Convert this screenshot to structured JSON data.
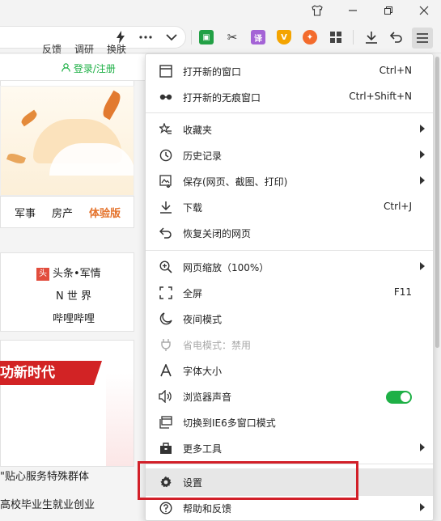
{
  "titlebar": {
    "icons": [
      "shirt-icon",
      "minimize-icon",
      "restore-icon",
      "close-icon"
    ]
  },
  "toolbar": {
    "icons": [
      "lightning-icon",
      "more-icon",
      "chevron-down-icon"
    ],
    "extensions": [
      {
        "name": "book-extension-icon",
        "color": "#22a045",
        "glyph": "▣"
      },
      {
        "name": "scissors-icon",
        "color": "#444444",
        "glyph": "✂"
      },
      {
        "name": "translate-extension-icon",
        "color": "#a463d6",
        "glyph": "译"
      },
      {
        "name": "shield-extension-icon",
        "color": "#f4a400",
        "glyph": "V"
      },
      {
        "name": "gamepad-extension-icon",
        "color": "#f36b2c",
        "glyph": "✦"
      },
      {
        "name": "apps-grid-icon",
        "color": "#444444",
        "glyph": "▦"
      }
    ],
    "right_icons": [
      "download-icon",
      "undo-icon",
      "menu-icon"
    ]
  },
  "page": {
    "top_links": [
      "反馈",
      "调研",
      "换肤"
    ],
    "login": "登录/注册",
    "nav": [
      "军事",
      "房产",
      "体验版"
    ],
    "list": {
      "item1_badge": "头",
      "item1": "头条•军情",
      "item2": "N 世 界",
      "item3": "哔哩哔哩"
    },
    "news": {
      "headline": "功新时代",
      "line1": "\"贴心服务特殊群体",
      "line2": "高校毕业生就业创业"
    }
  },
  "menu": {
    "items": [
      {
        "label": "打开新的窗口",
        "shortcut": "Ctrl+N",
        "icon": "window-icon"
      },
      {
        "label": "打开新的无痕窗口",
        "shortcut": "Ctrl+Shift+N",
        "icon": "incognito-icon"
      },
      {
        "label": "收藏夹",
        "icon": "star-list-icon"
      },
      {
        "label": "历史记录",
        "icon": "clock-icon"
      },
      {
        "label": "保存(网页、截图、打印)",
        "icon": "save-image-icon"
      },
      {
        "label": "下载",
        "shortcut": "Ctrl+J",
        "icon": "download-icon"
      },
      {
        "label": "恢复关闭的网页",
        "icon": "undo-icon"
      },
      {
        "label": "网页缩放（100%）",
        "icon": "zoom-icon"
      },
      {
        "label": "全屏",
        "shortcut": "F11",
        "icon": "fullscreen-icon"
      },
      {
        "label": "夜间模式",
        "icon": "moon-icon"
      },
      {
        "label": "省电模式：禁用",
        "icon": "plug-icon"
      },
      {
        "label": "字体大小",
        "icon": "font-icon"
      },
      {
        "label": "浏览器声音",
        "icon": "speaker-icon",
        "toggle": "on"
      },
      {
        "label": "切换到IE6多窗口模式",
        "icon": "ie-window-icon"
      },
      {
        "label": "更多工具",
        "icon": "toolbox-icon"
      },
      {
        "label": "设置",
        "icon": "gear-icon"
      },
      {
        "label": "帮助和反馈",
        "icon": "help-icon"
      }
    ]
  },
  "colors": {
    "accent_green": "#1eb046",
    "highlight_red": "#d21f28",
    "menu_hover": "#e7e7e7"
  }
}
